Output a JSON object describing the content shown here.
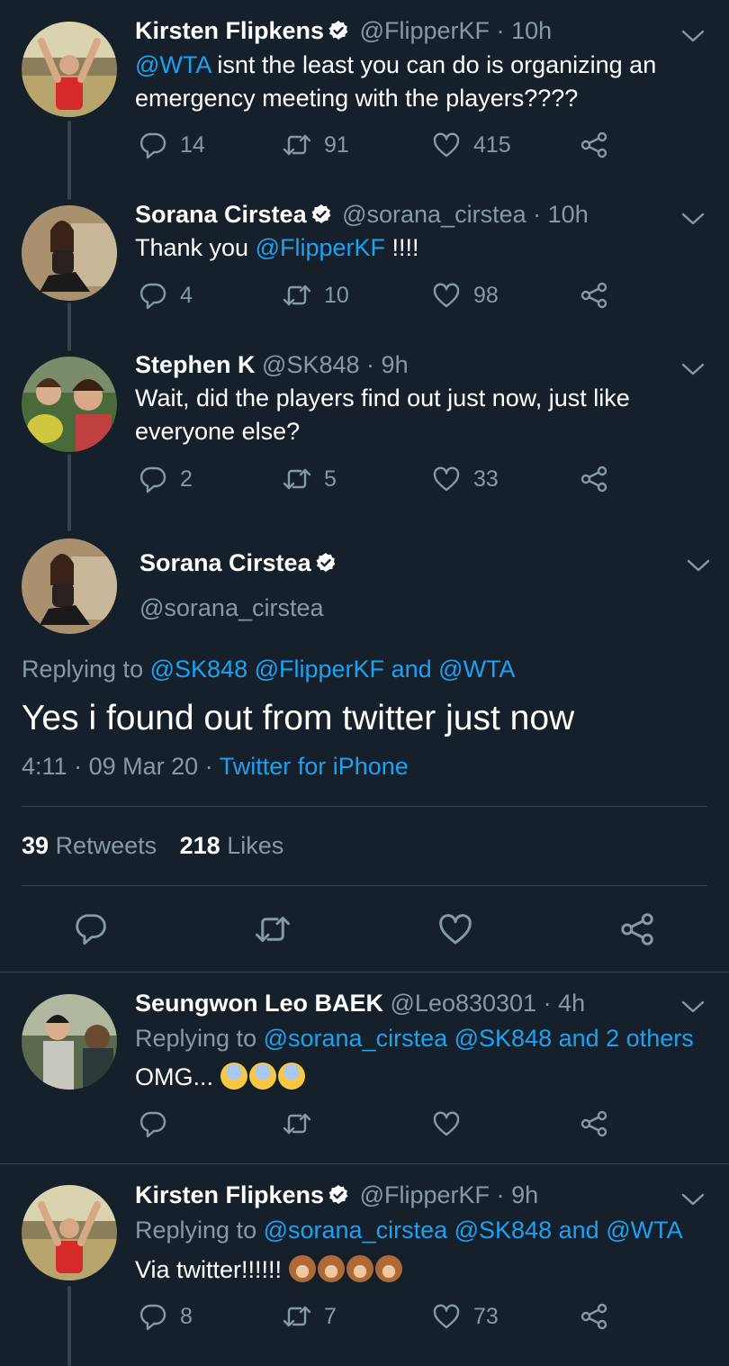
{
  "tweets": [
    {
      "name": "Kirsten Flipkens",
      "handle": "@FlipperKF",
      "sep": "·",
      "time": "10h",
      "mention": "@WTA",
      "text": " isnt the least you can do is organizing an emergency meeting with the players????",
      "replies": "14",
      "retweets": "91",
      "likes": "415"
    },
    {
      "name": "Sorana Cirstea",
      "handle": "@sorana_cirstea",
      "sep": "·",
      "time": "10h",
      "text_pre": "Thank you ",
      "mention": "@FlipperKF",
      "text_post": " !!!!",
      "replies": "4",
      "retweets": "10",
      "likes": "98"
    },
    {
      "name": "Stephen K",
      "handle": "@SK848",
      "sep": "·",
      "time": "9h",
      "text": "Wait, did the players find out just now, just like everyone else?",
      "replies": "2",
      "retweets": "5",
      "likes": "33"
    }
  ],
  "main": {
    "name": "Sorana Cirstea",
    "handle": "@sorana_cirstea",
    "replying_label": "Replying to",
    "replying_to": [
      "@SK848",
      "@FlipperKF"
    ],
    "and": "and",
    "replying_last": "@WTA",
    "text": "Yes i found out from twitter just now",
    "time": "4:11",
    "sep1": "·",
    "date": "09 Mar 20",
    "sep2": "·",
    "source": "Twitter for iPhone",
    "retweet_count": "39",
    "retweet_label": "Retweets",
    "like_count": "218",
    "like_label": "Likes"
  },
  "replies": [
    {
      "name": "Seungwon Leo BAEK",
      "handle": "@Leo830301",
      "sep": "·",
      "time": "4h",
      "replying_label": "Replying to",
      "replying_to": "@sorana_cirstea @SK848",
      "and_others": "and 2 others",
      "text": "OMG...",
      "emoji": "anxious-face-with-sweat",
      "emoji_count": 3
    },
    {
      "name": "Kirsten Flipkens",
      "handle": "@FlipperKF",
      "sep": "·",
      "time": "9h",
      "replying_label": "Replying to",
      "replying_to": "@sorana_cirstea @SK848",
      "and": "and",
      "replying_last": "@WTA",
      "text": "Via twitter!!!!!!",
      "emoji": "see-no-evil-monkey",
      "emoji_count": 4,
      "replies": "8",
      "retweets": "7",
      "likes": "73"
    }
  ],
  "colors": {
    "background": "#15202b",
    "link": "#1da1f2",
    "secondary_text": "#8899a6",
    "divider": "#38444d"
  }
}
